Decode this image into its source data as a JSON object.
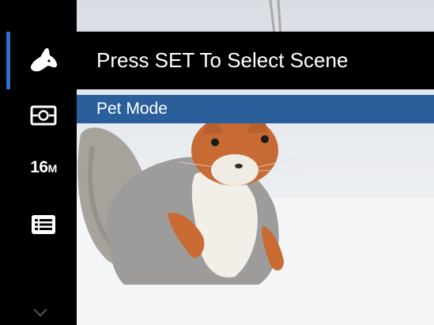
{
  "header": {
    "title": "Press SET To Select Scene"
  },
  "scene_list": {
    "selected_label": "Pet Mode"
  },
  "sidebar": {
    "items": [
      {
        "icon": "pet-mode-icon",
        "selected": true
      },
      {
        "icon": "metering-icon",
        "selected": false
      },
      {
        "icon": "resolution-icon",
        "value": "16",
        "unit": "M",
        "selected": false
      },
      {
        "icon": "menu-list-icon",
        "selected": false
      }
    ],
    "more_indicator": "chevron-down-icon"
  },
  "colors": {
    "selection_accent": "#2f6fd1",
    "option_highlight": "#2a5f9c",
    "background": "#000000"
  }
}
